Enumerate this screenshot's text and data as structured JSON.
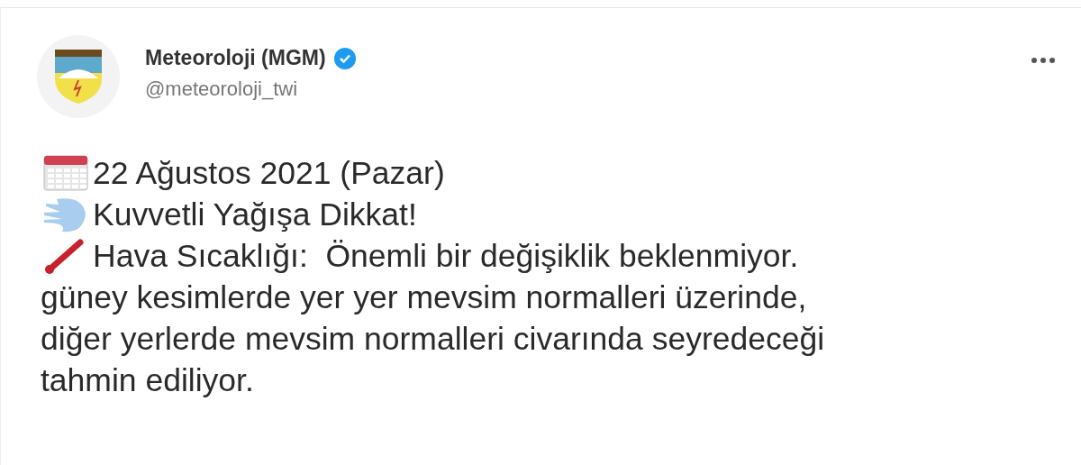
{
  "tweet": {
    "author": {
      "name": "Meteoroloji (MGM)",
      "handle": "@meteoroloji_twi",
      "verified": true
    },
    "lines": [
      {
        "kind": "calendar",
        "text": "22 Ağustos 2021 (Pazar)"
      },
      {
        "kind": "wind",
        "text": "Kuvvetli Yağışa Dikkat!"
      },
      {
        "kind": "thermometer",
        "text": "Hava Sıcaklığı:  Önemli bir değişiklik beklenmiyor."
      },
      {
        "kind": "plain",
        "text": "güney kesimlerde yer yer mevsim normalleri üzerinde,"
      },
      {
        "kind": "plain",
        "text": "diğer yerlerde mevsim normalleri civarında seyredeceği"
      },
      {
        "kind": "plain",
        "text": "tahmin ediliyor."
      }
    ]
  }
}
